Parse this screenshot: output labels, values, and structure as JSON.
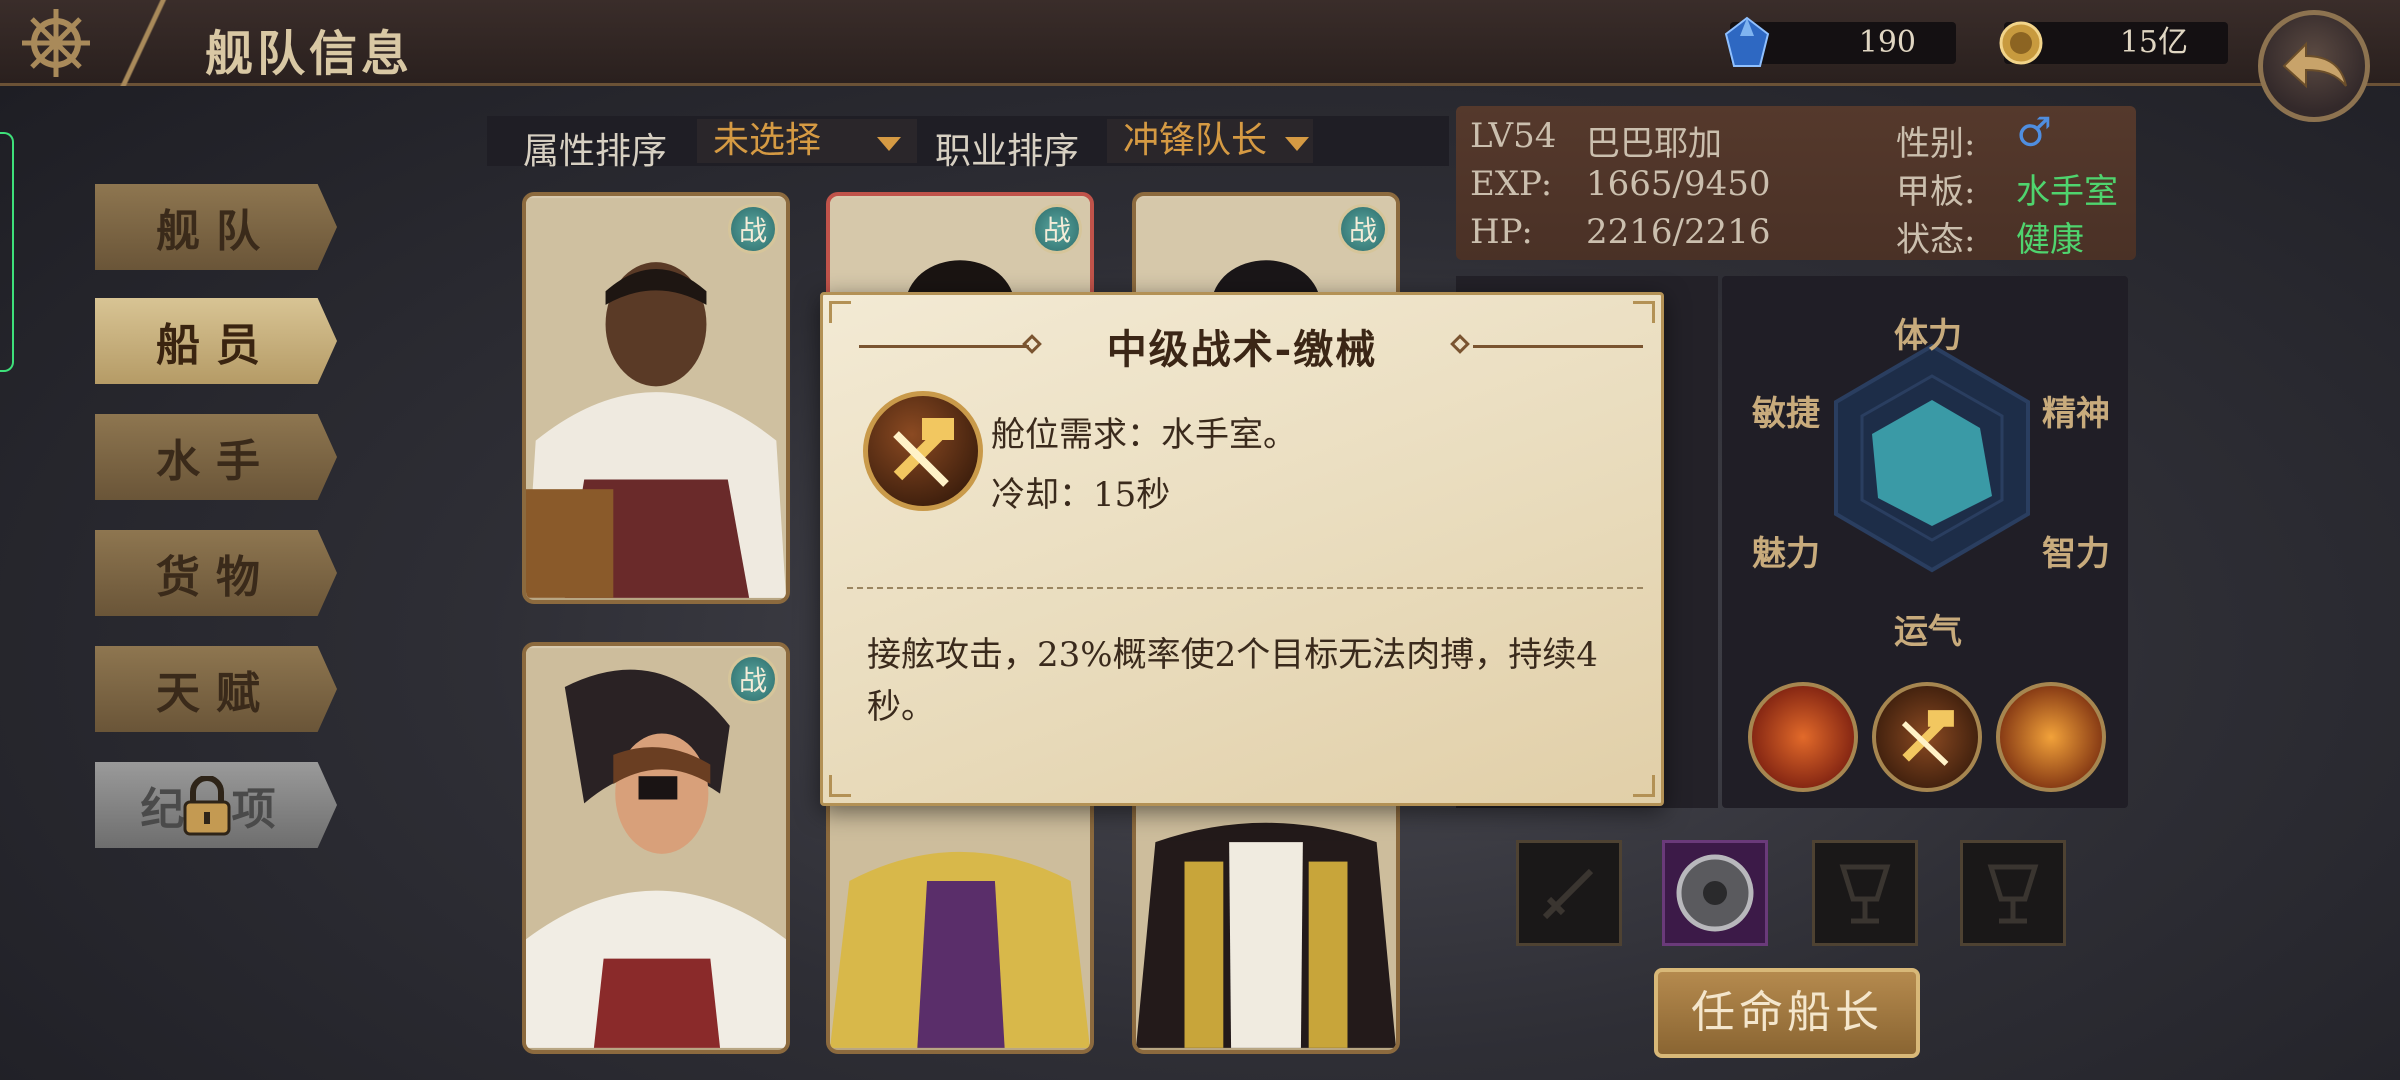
{
  "header": {
    "title": "舰队信息",
    "gems": "190",
    "coins": "15亿"
  },
  "menu": {
    "items": [
      {
        "label": "舰队"
      },
      {
        "label": "船员"
      },
      {
        "label": "水手"
      },
      {
        "label": "货物"
      },
      {
        "label": "天赋"
      },
      {
        "label": "纪 项"
      }
    ]
  },
  "sort": {
    "attr_label": "属性排序",
    "attr_value": "未选择",
    "job_label": "职业排序",
    "job_value": "冲锋队长"
  },
  "cards": {
    "badge": "战"
  },
  "captain": {
    "level": "LV54",
    "name": "巴巴耶加",
    "exp_label": "EXP:",
    "exp_value": "1665/9450",
    "hp_label": "HP:",
    "hp_value": "2216/2216",
    "gender_label": "性别:",
    "gender_value": "♂",
    "deck_label": "甲板:",
    "deck_value": "水手室",
    "status_label": "状态:",
    "status_value": "健康"
  },
  "attributes": {
    "stamina": "体力",
    "spirit": "精神",
    "intellect": "智力",
    "luck": "运气",
    "charm": "魅力",
    "agility": "敏捷"
  },
  "appoint_label": "任命船长",
  "tooltip": {
    "title": "中级战术-缴械",
    "requirement": "舱位需求：水手室。",
    "cooldown": "冷却：15秒",
    "description": "接舷攻击，23%概率使2个目标无法肉搏，持续4秒。"
  },
  "colors": {
    "accent_gold": "#d59a43",
    "status_green": "#4fd46e",
    "gender_blue": "#4f8ee0",
    "radar_fill": "#3a9aa6"
  }
}
